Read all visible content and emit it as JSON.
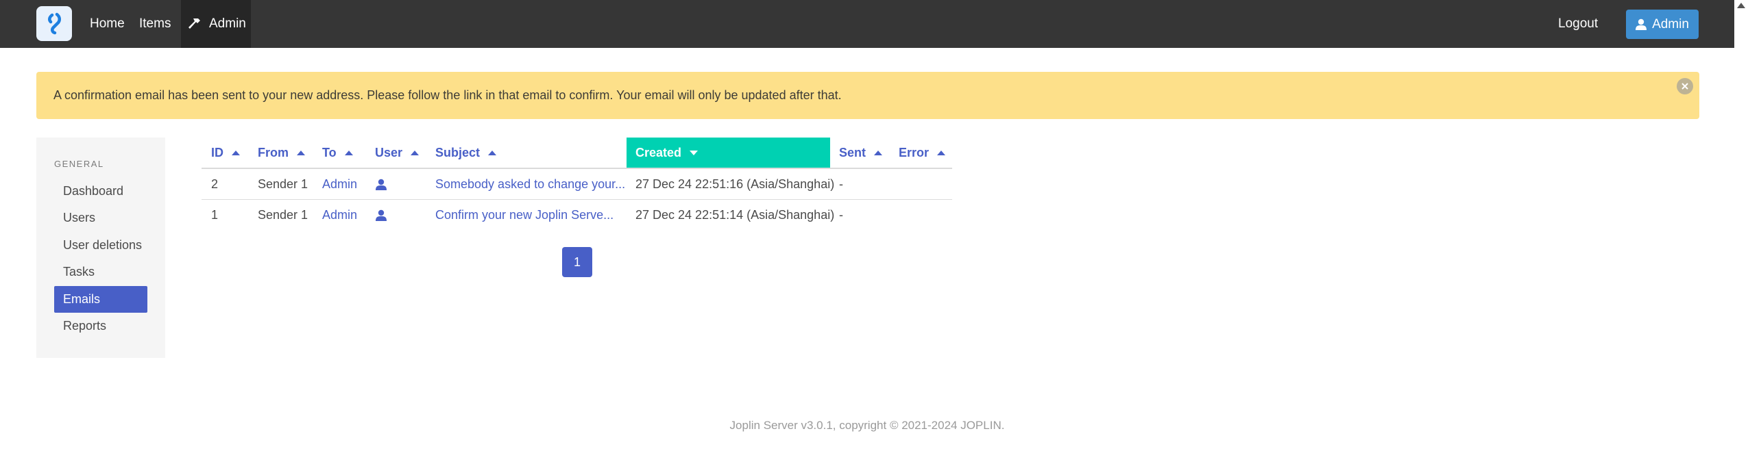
{
  "nav": {
    "home": "Home",
    "items": "Items",
    "admin": "Admin",
    "logout": "Logout",
    "user_button": "Admin"
  },
  "notification": {
    "message": "A confirmation email has been sent to your new address. Please follow the link in that email to confirm. Your email will only be updated after that."
  },
  "sidebar": {
    "section_label": "GENERAL",
    "items": [
      {
        "label": "Dashboard"
      },
      {
        "label": "Users"
      },
      {
        "label": "User deletions"
      },
      {
        "label": "Tasks"
      },
      {
        "label": "Emails"
      },
      {
        "label": "Reports"
      }
    ],
    "active_item": "Emails"
  },
  "table": {
    "columns": {
      "id": "ID",
      "from": "From",
      "to": "To",
      "user": "User",
      "subject": "Subject",
      "created": "Created",
      "sent": "Sent",
      "error": "Error"
    },
    "sorted_column": "Created",
    "sort_direction": "descending",
    "rows": [
      {
        "id": "2",
        "from": "Sender 1",
        "to": "Admin",
        "user_icon": "user-icon",
        "subject": "Somebody asked to change your...",
        "created": "27 Dec 24 22:51:16 (Asia/Shanghai)",
        "sent": "-",
        "error": ""
      },
      {
        "id": "1",
        "from": "Sender 1",
        "to": "Admin",
        "user_icon": "user-icon",
        "subject": "Confirm your new Joplin Serve...",
        "created": "27 Dec 24 22:51:14 (Asia/Shanghai)",
        "sent": "-",
        "error": ""
      }
    ]
  },
  "pagination": {
    "current_page": "1"
  },
  "footer": {
    "text": "Joplin Server v3.0.1, copyright © 2021-2024 JOPLIN."
  },
  "colors": {
    "navbar": "#363636",
    "primary": "#485fc7",
    "sorted_header": "#00d1b2",
    "notification": "#fde08a",
    "admin_button": "#3e8ed0"
  }
}
